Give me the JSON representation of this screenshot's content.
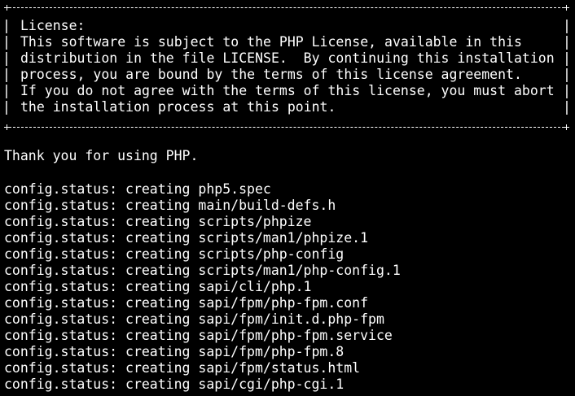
{
  "terminal": {
    "license_box": {
      "lines": [
        "License:",
        "This software is subject to the PHP License, available in this",
        "distribution in the file LICENSE.  By continuing this installation",
        "process, you are bound by the terms of this license agreement.",
        "If you do not agree with the terms of this license, you must abort",
        "the installation process at this point."
      ]
    },
    "thanks_line": "Thank you for using PHP.",
    "status_lines": [
      "config.status: creating php5.spec",
      "config.status: creating main/build-defs.h",
      "config.status: creating scripts/phpize",
      "config.status: creating scripts/man1/phpize.1",
      "config.status: creating scripts/php-config",
      "config.status: creating scripts/man1/php-config.1",
      "config.status: creating sapi/cli/php.1",
      "config.status: creating sapi/fpm/php-fpm.conf",
      "config.status: creating sapi/fpm/init.d.php-fpm",
      "config.status: creating sapi/fpm/php-fpm.service",
      "config.status: creating sapi/fpm/php-fpm.8",
      "config.status: creating sapi/fpm/status.html",
      "config.status: creating sapi/cgi/php-cgi.1"
    ]
  }
}
